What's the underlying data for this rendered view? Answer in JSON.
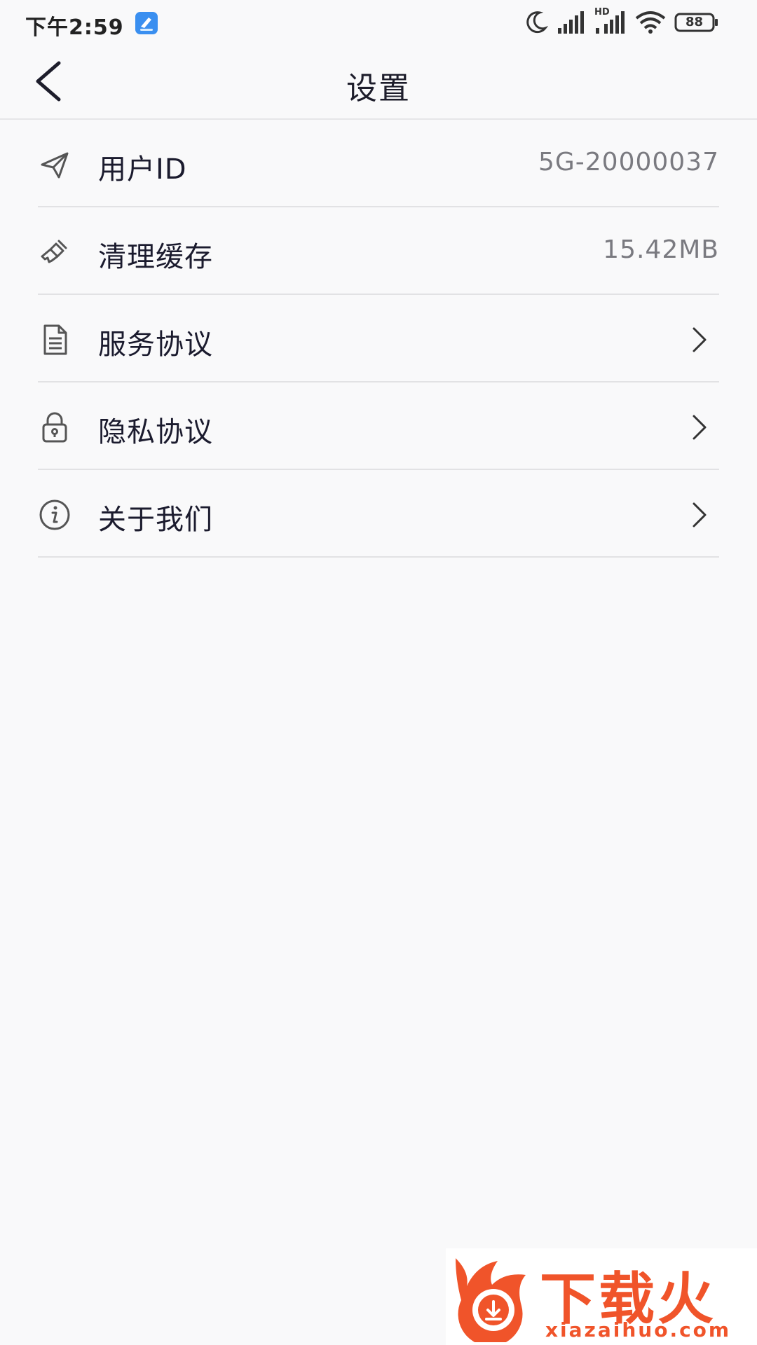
{
  "status_bar": {
    "time": "下午2:59",
    "network_label": "HD",
    "battery": "88"
  },
  "header": {
    "title": "设置"
  },
  "settings": [
    {
      "icon": "paper-plane-icon",
      "label": "用户ID",
      "value": "5G-20000037"
    },
    {
      "icon": "brush-icon",
      "label": "清理缓存",
      "value": "15.42MB"
    },
    {
      "icon": "document-icon",
      "label": "服务协议"
    },
    {
      "icon": "lock-icon",
      "label": "隐私协议"
    },
    {
      "icon": "info-icon",
      "label": "关于我们"
    }
  ],
  "watermark": {
    "brand": "下载火",
    "url": "xiazaihuo.com"
  },
  "colors": {
    "background": "#f9f9fa",
    "text": "#1b1b2e",
    "secondary_text": "#7a7a80",
    "divider": "#e2e2e4",
    "watermark": "#f0542a"
  }
}
